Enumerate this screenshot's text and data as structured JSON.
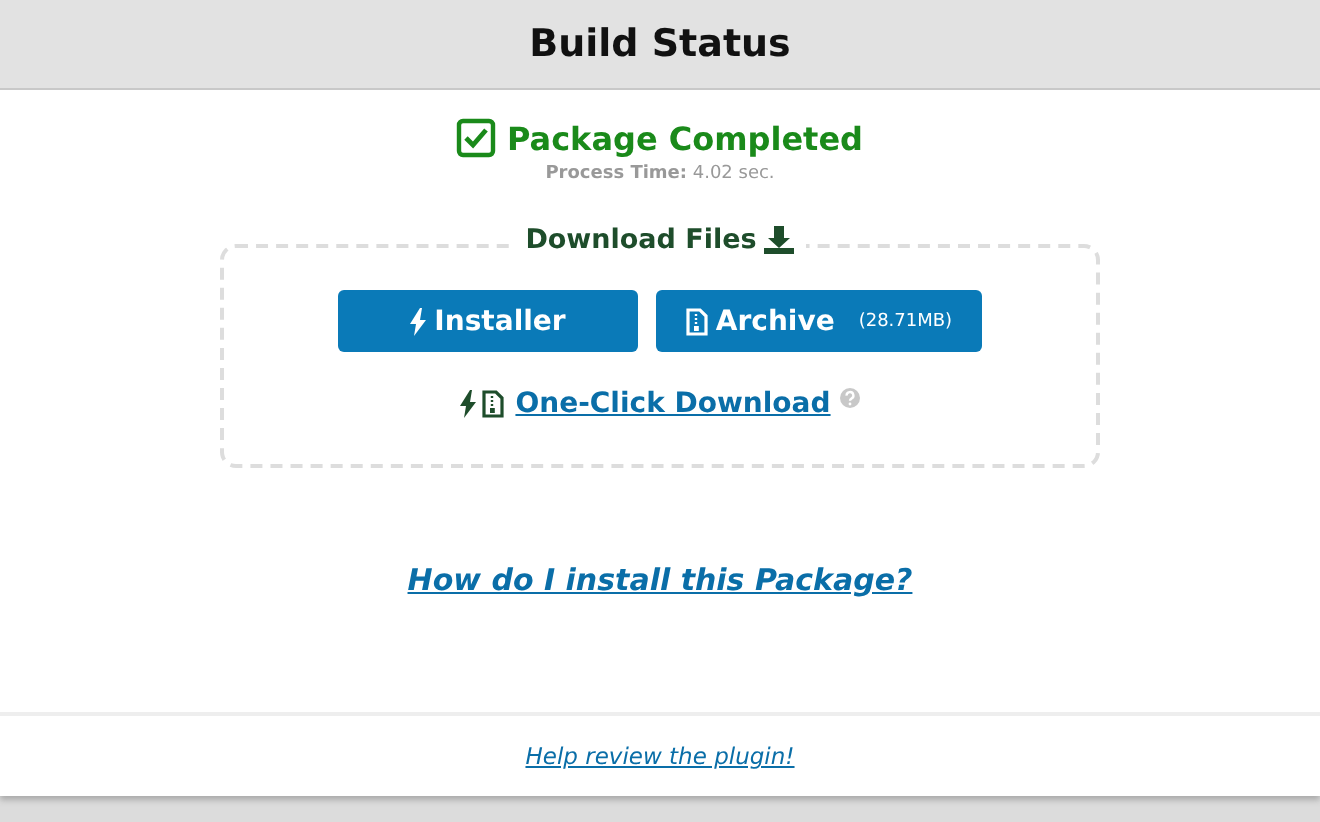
{
  "header": {
    "title": "Build Status"
  },
  "status": {
    "kind": "completed",
    "label": "Package Completed",
    "process_time": "**Process Time:** 4.02 sec."
  },
  "downloads": {
    "legend": "Download Files",
    "buttons": [
      {
        "kind": "installer",
        "label": "Installer"
      },
      {
        "kind": "archive",
        "label": "Archive",
        "size": "(28.71MB)"
      }
    ],
    "one_click": {
      "label": "One-Click Download"
    }
  },
  "install_help_link": "How do I install this Package?",
  "review_link": "Help review the plugin!"
}
